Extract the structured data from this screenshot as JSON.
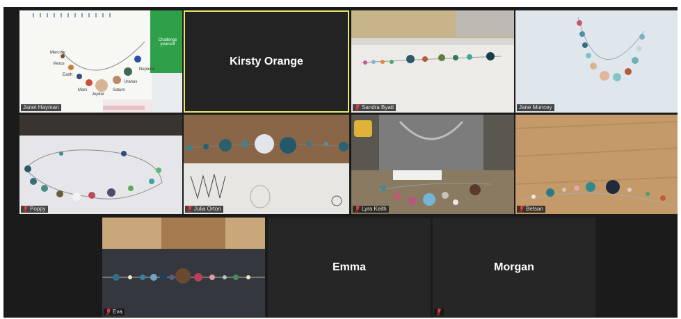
{
  "participants": [
    {
      "name": "Janet Hayman",
      "muted": false
    },
    {
      "name": "Kirsty Orange",
      "muted": false
    },
    {
      "name": "Sandra Byatt",
      "muted": true
    },
    {
      "name": "Jane Muncey",
      "muted": false
    },
    {
      "name": "Poppy",
      "muted": true
    },
    {
      "name": "Julia Orton",
      "muted": true
    },
    {
      "name": "Lyra Keith",
      "muted": true
    },
    {
      "name": "Betsan",
      "muted": true
    },
    {
      "name": "Eva",
      "muted": true
    },
    {
      "name": "Emma",
      "muted": false
    },
    {
      "name": "Morgan",
      "muted": true
    }
  ],
  "video_text": {
    "planets": [
      "Mercury",
      "Venus",
      "Earth",
      "Mars",
      "Jupiter",
      "Saturn",
      "Uranus",
      "Neptune"
    ],
    "tablet_side": [
      "Challenge yourself"
    ]
  },
  "colors": {
    "active_speaker": "#e8e86a",
    "mic_muted": "#e0393e",
    "tile_bg": "#262626"
  }
}
